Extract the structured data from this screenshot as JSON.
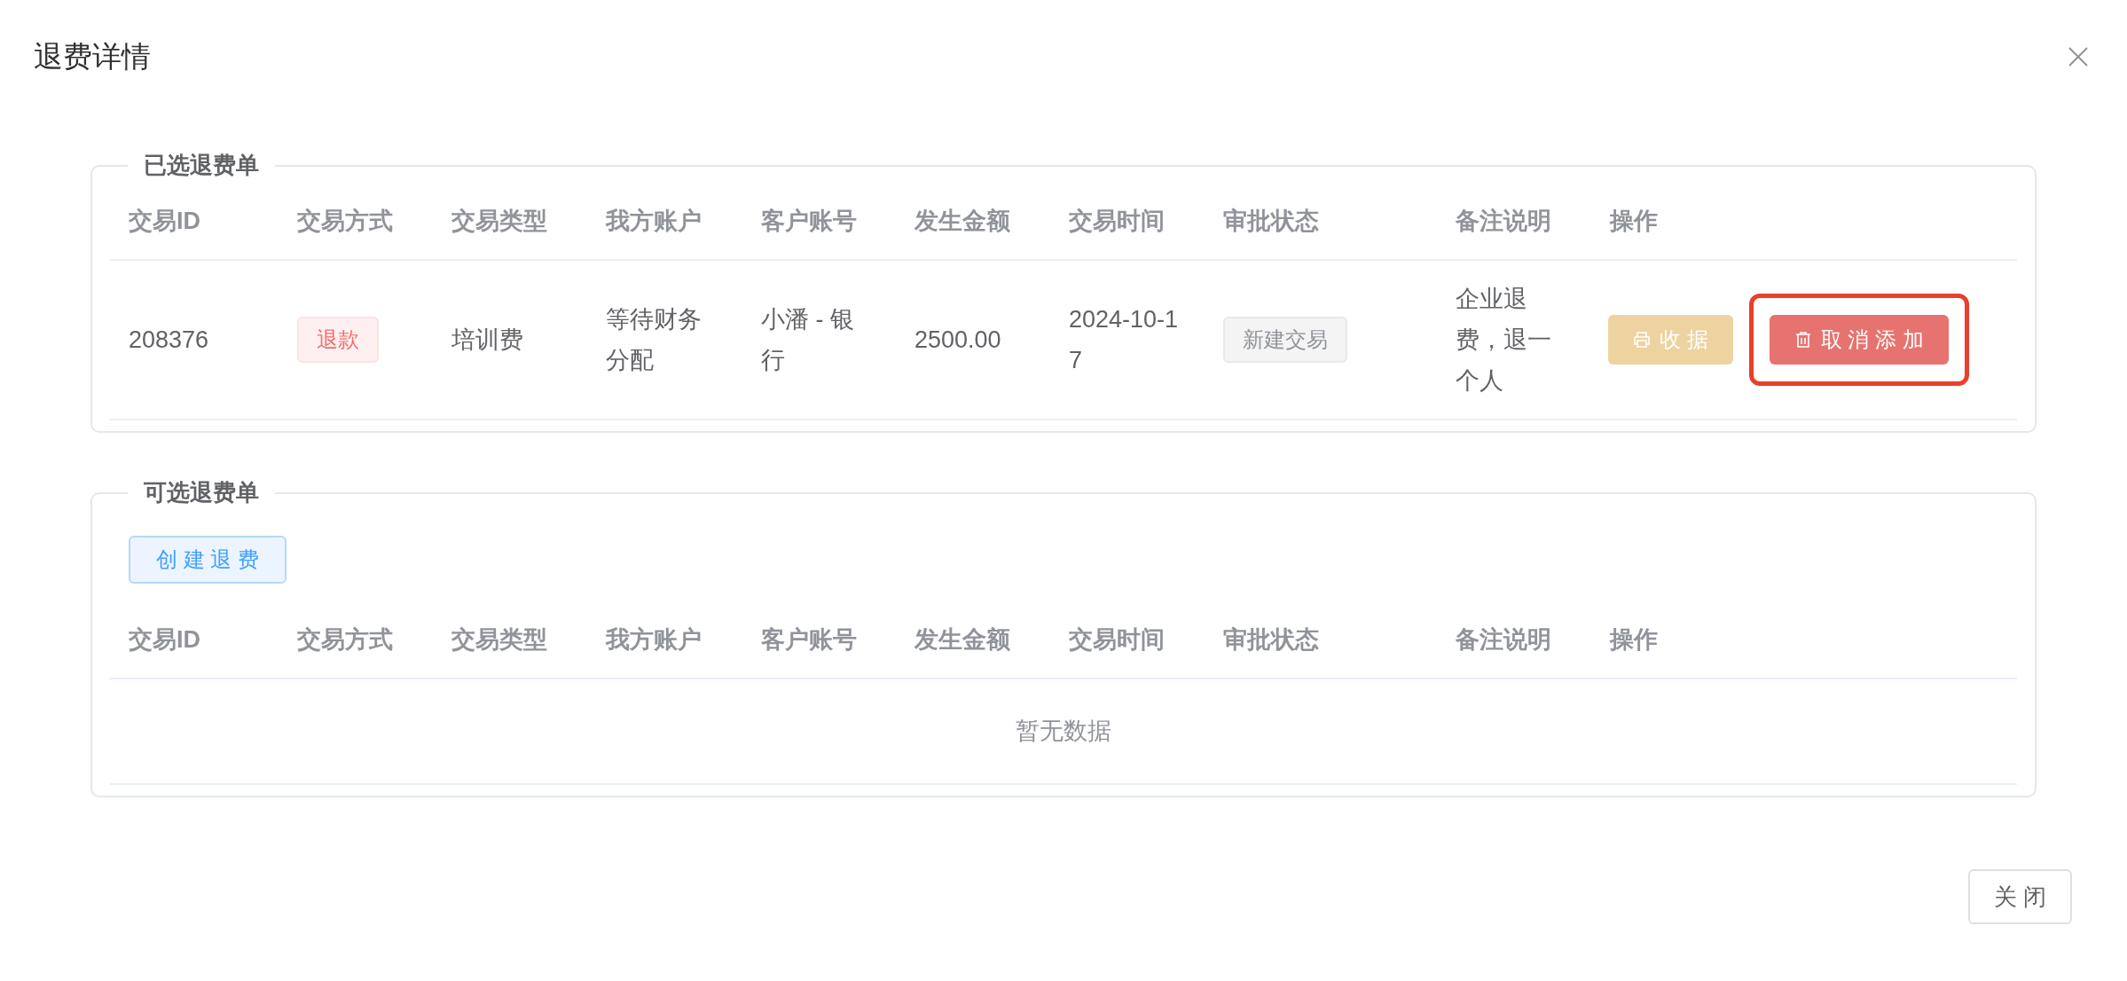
{
  "dialog": {
    "title": "退费详情"
  },
  "selected_section": {
    "legend": "已选退费单",
    "columns": [
      "交易ID",
      "交易方式",
      "交易类型",
      "我方账户",
      "客户账号",
      "发生金额",
      "交易时间",
      "审批状态",
      "备注说明",
      "操作"
    ],
    "rows": [
      {
        "id": "208376",
        "method": {
          "text": "退款",
          "kind": "danger"
        },
        "type": "培训费",
        "our_account": "等待财务分配",
        "customer_account": "小潘 - 银行",
        "amount": "2500.00",
        "time": "2024-10-17",
        "approval_status": {
          "text": "新建交易",
          "kind": "info"
        },
        "remark": "企业退费，退一个人",
        "actions": [
          {
            "label": "收 据",
            "kind": "warning",
            "highlighted": false
          },
          {
            "label": "取 消 添 加",
            "kind": "danger",
            "highlighted": true
          }
        ]
      }
    ]
  },
  "available_section": {
    "legend": "可选退费单",
    "create_button": "创 建 退 费",
    "columns": [
      "交易ID",
      "交易方式",
      "交易类型",
      "我方账户",
      "客户账号",
      "发生金额",
      "交易时间",
      "审批状态",
      "备注说明",
      "操作"
    ],
    "empty_text": "暂无数据"
  },
  "footer": {
    "close_button": "关 闭"
  }
}
